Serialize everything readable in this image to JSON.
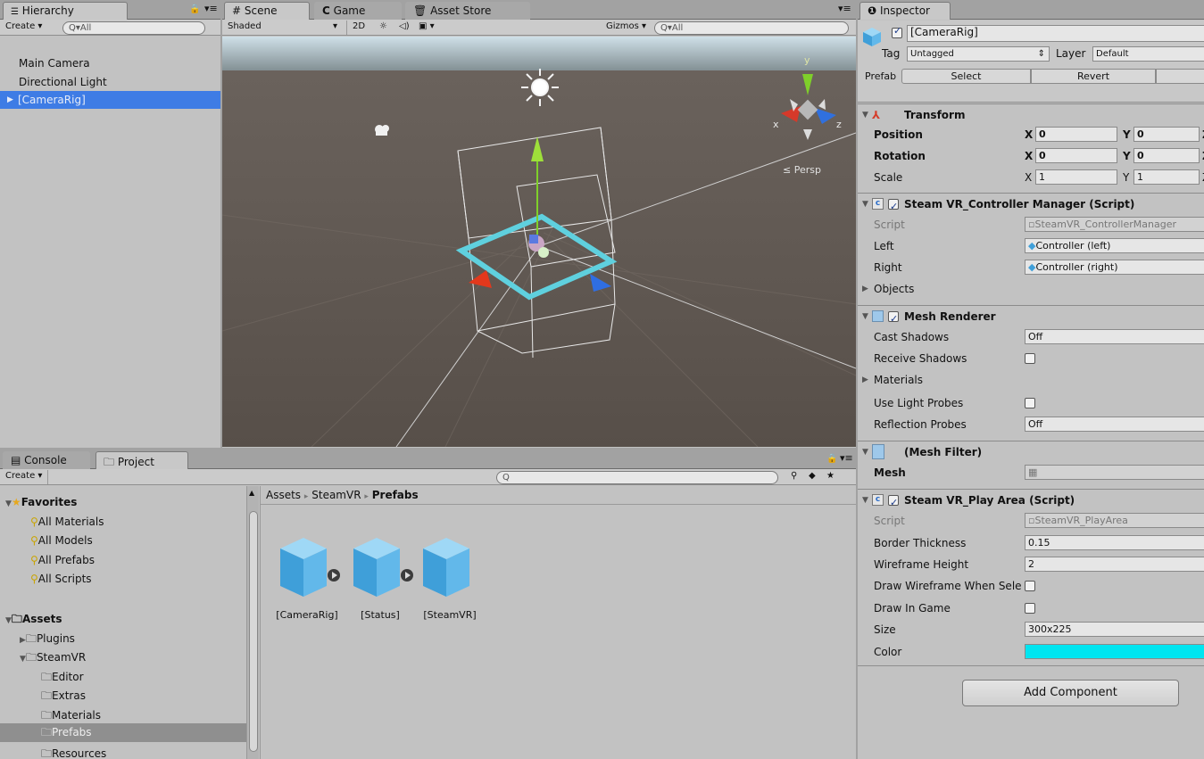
{
  "hierarchy": {
    "tab_label": "Hierarchy",
    "create_label": "Create",
    "search_placeholder": "Q▾All",
    "items": [
      {
        "label": "Main Camera"
      },
      {
        "label": "Directional Light"
      },
      {
        "label": "[CameraRig]"
      }
    ]
  },
  "scene": {
    "tabs": [
      {
        "label": "Scene"
      },
      {
        "label": "Game"
      },
      {
        "label": "Asset Store"
      }
    ],
    "shading_mode": "Shaded",
    "mode_2d": "2D",
    "gizmos_label": "Gizmos",
    "search_placeholder": "Q▾All",
    "persp_label": "≤ Persp",
    "axis_y": "y",
    "axis_x": "x",
    "axis_z": "z"
  },
  "project": {
    "tabs": [
      {
        "label": "Console"
      },
      {
        "label": "Project"
      }
    ],
    "create_label": "Create",
    "search_placeholder": "Q",
    "favorites": {
      "label": "Favorites",
      "items": [
        {
          "label": "All Materials"
        },
        {
          "label": "All Models"
        },
        {
          "label": "All Prefabs"
        },
        {
          "label": "All Scripts"
        }
      ]
    },
    "assets": {
      "label": "Assets",
      "items": [
        {
          "label": "Plugins"
        },
        {
          "label": "SteamVR"
        },
        {
          "label": "Editor"
        },
        {
          "label": "Extras"
        },
        {
          "label": "Materials"
        },
        {
          "label": "Prefabs"
        },
        {
          "label": "Resources"
        }
      ]
    },
    "breadcrumb": {
      "part1": "Assets",
      "part2": "SteamVR",
      "part3": "Prefabs",
      "sep": "▸"
    },
    "prefabs": [
      {
        "label": "[CameraRig]"
      },
      {
        "label": "[Status]"
      },
      {
        "label": "[SteamVR]"
      }
    ]
  },
  "inspector": {
    "tab_label": "Inspector",
    "object_name": "[CameraRig]",
    "tag_label": "Tag",
    "tag_value": "Untagged",
    "layer_label": "Layer",
    "layer_value": "Default",
    "prefab_label": "Prefab",
    "select_label": "Select",
    "revert_label": "Revert",
    "transform": {
      "title": "Transform",
      "position_label": "Position",
      "rotation_label": "Rotation",
      "scale_label": "Scale",
      "x": "X",
      "y": "Y",
      "z": "Z",
      "position": {
        "x": "0",
        "y": "0"
      },
      "rotation": {
        "x": "0",
        "y": "0"
      },
      "scale": {
        "x": "1",
        "y": "1"
      }
    },
    "controller_manager": {
      "title": "Steam VR_Controller Manager (Script)",
      "script_label": "Script",
      "script_value": "SteamVR_ControllerManager",
      "left_label": "Left",
      "left_value": "Controller (left)",
      "right_label": "Right",
      "right_value": "Controller (right)",
      "objects_label": "Objects"
    },
    "mesh_renderer": {
      "title": "Mesh Renderer",
      "cast_shadows_label": "Cast Shadows",
      "cast_shadows_value": "Off",
      "receive_shadows_label": "Receive Shadows",
      "materials_label": "Materials",
      "light_probes_label": "Use Light Probes",
      "reflection_probes_label": "Reflection Probes",
      "reflection_probes_value": "Off"
    },
    "mesh_filter": {
      "title": "(Mesh Filter)",
      "mesh_label": "Mesh"
    },
    "play_area": {
      "title": "Steam VR_Play Area (Script)",
      "script_label": "Script",
      "script_value": "SteamVR_PlayArea",
      "border_label": "Border Thickness",
      "border_value": "0.15",
      "wire_height_label": "Wireframe Height",
      "wire_height_value": "2",
      "draw_wire_label": "Draw Wireframe When Sele",
      "draw_game_label": "Draw In Game",
      "size_label": "Size",
      "size_value": "300x225",
      "color_label": "Color",
      "color_value": "#00e5f0"
    },
    "add_component_label": "Add Component"
  },
  "colors": {
    "selection": "#3e7ce5",
    "scene_ground": "#5a524c",
    "scene_sky": "#b4c8d2",
    "play_area_cyan": "#5fd0de"
  }
}
